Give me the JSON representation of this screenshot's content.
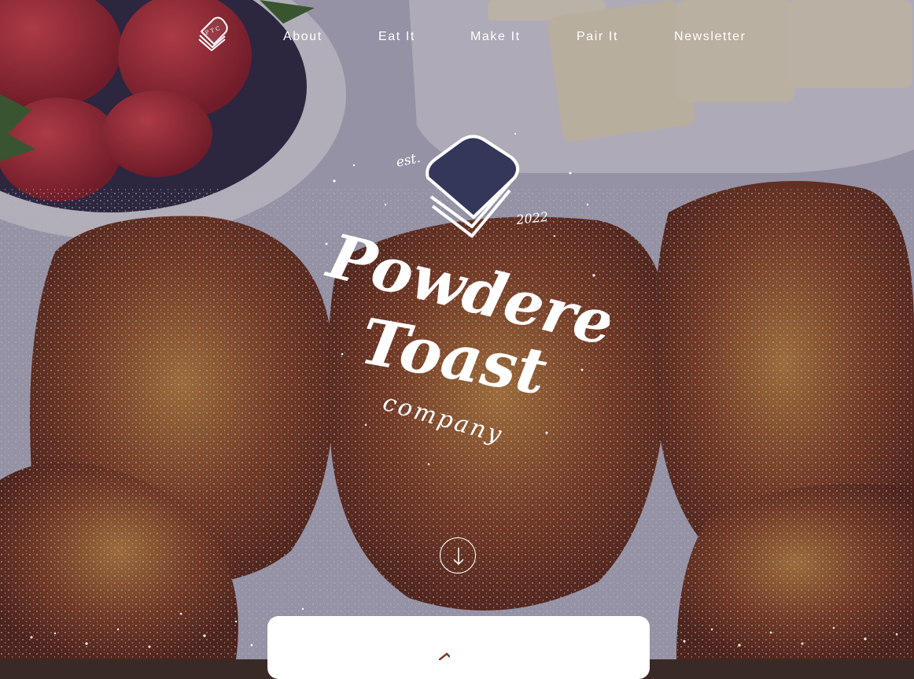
{
  "nav": {
    "logo_monogram": "P T C",
    "links": [
      {
        "label": "About"
      },
      {
        "label": "Eat It"
      },
      {
        "label": "Make It"
      },
      {
        "label": "Pair It"
      },
      {
        "label": "Newsletter"
      }
    ]
  },
  "brand": {
    "est_label": "est.",
    "year": "2022",
    "word1": "Powdered",
    "word2": "Toast",
    "word3": "company"
  },
  "scroll": {
    "icon": "arrow-down-icon"
  },
  "colors": {
    "text": "#ffffff",
    "card": "#ffffff",
    "toast": "#7a3a22",
    "plate": "#dcd9e6"
  }
}
